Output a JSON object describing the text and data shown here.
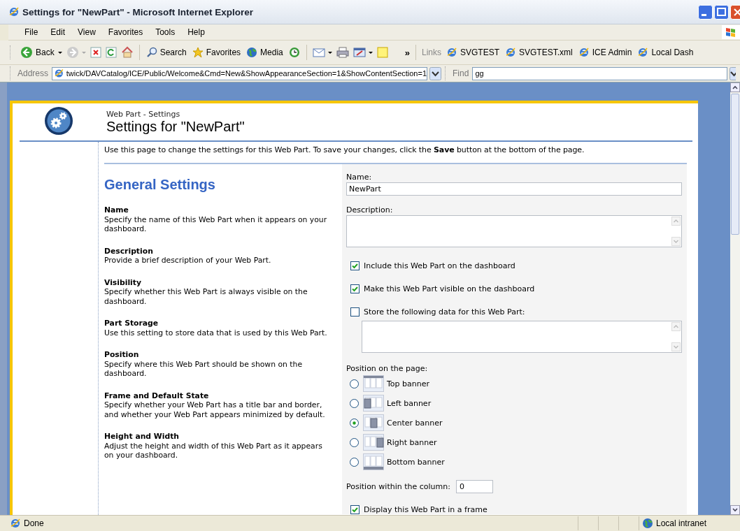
{
  "window": {
    "title": "Settings for \"NewPart\" - Microsoft Internet Explorer"
  },
  "menu": [
    "File",
    "Edit",
    "View",
    "Favorites",
    "Tools",
    "Help"
  ],
  "toolbar": {
    "back": "Back",
    "search": "Search",
    "favorites": "Favorites",
    "media": "Media",
    "more": "»",
    "links_label": "Links",
    "links": [
      "SVGTEST",
      "SVGTEST.xml",
      "ICE Admin",
      "Local Dash"
    ]
  },
  "address": {
    "label": "Address",
    "value": "twick/DAVCatalog/ICE/Public/Welcome&Cmd=New&ShowAppearanceSection=1&ShowContentSection=1"
  },
  "find": {
    "label": "Find",
    "value": "gg"
  },
  "page": {
    "breadcrumb": "Web Part - Settings",
    "title": "Settings for \"NewPart\"",
    "intro": "Use this page to change the settings for this Web Part. To save your changes, click the **Save** button at the bottom of the page.",
    "section_title": "General Settings",
    "help": [
      {
        "heading": "Name",
        "text": "Specify the name of this Web Part when it appears on your dashboard."
      },
      {
        "heading": "Description",
        "text": "Provide a brief description of your Web Part."
      },
      {
        "heading": "Visibility",
        "text": "Specify whether this Web Part is always visible on the dashboard."
      },
      {
        "heading": "Part Storage",
        "text": "Use this setting to store data that is used by this Web Part."
      },
      {
        "heading": "Position",
        "text": "Specify where this Web Part should be shown on the dashboard."
      },
      {
        "heading": "Frame and Default State",
        "text": "Specify whether your Web Part has a title bar and border, and whether your Web Part appears minimized by default."
      },
      {
        "heading": "Height and Width",
        "text": "Adjust the height and width of this Web Part as it appears on your dashboard."
      }
    ],
    "form": [
      {
        "kind": "text",
        "label": "Name:",
        "value": "NewPart"
      },
      {
        "kind": "textarea",
        "label": "Description:"
      },
      {
        "kind": "checkbox",
        "label": "Include this Web Part on the dashboard",
        "checked": true
      },
      {
        "kind": "checkbox",
        "label": "Make this Web Part visible on the dashboard",
        "checked": true
      },
      {
        "kind": "checkbox",
        "label": "Store the following data for this Web Part:",
        "checked": false
      },
      {
        "kind": "subtextarea"
      },
      {
        "kind": "radios",
        "label": "Position on the page:",
        "options": [
          {
            "label": "Top banner",
            "kind": "top",
            "selected": false
          },
          {
            "label": "Left banner",
            "kind": "left",
            "selected": false
          },
          {
            "label": "Center banner",
            "kind": "center",
            "selected": true
          },
          {
            "label": "Right banner",
            "kind": "right",
            "selected": false
          },
          {
            "label": "Bottom banner",
            "kind": "bottom",
            "selected": false
          }
        ]
      },
      {
        "kind": "inline",
        "label": "Position within the column:",
        "value": "0"
      },
      {
        "kind": "checkbox",
        "label": "Display this Web Part in a frame",
        "checked": true
      }
    ]
  },
  "status": {
    "text": "Done",
    "zone": "Local intranet"
  }
}
